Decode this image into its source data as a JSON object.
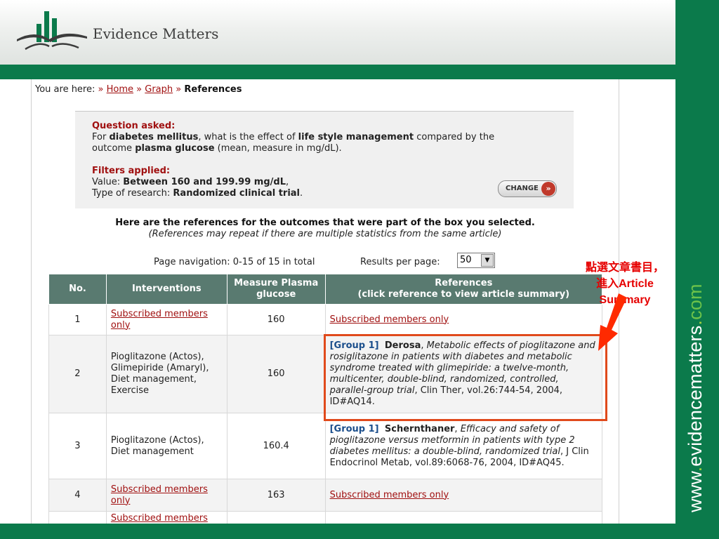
{
  "brand": {
    "name": "Evidence Matters",
    "url_prefix": "www",
    "url_dot": ".",
    "url_domain": "evidencematters",
    "url_dot2": ".",
    "url_tld": "com"
  },
  "breadcrumb": {
    "prefix": "You are here:",
    "sep": "»",
    "home": "Home",
    "graph": "Graph",
    "current": "References"
  },
  "question": {
    "title": "Question asked:",
    "line1_a": "For ",
    "line1_b": "diabetes mellitus",
    "line1_c": ", what is the effect of ",
    "line1_d": "life style management",
    "line1_e": " compared by the",
    "line2_a": "outcome ",
    "line2_b": "plasma glucose",
    "line2_c": " (mean, measure in mg/dL)."
  },
  "filters": {
    "title": "Filters applied:",
    "value_label": "Value: ",
    "value": "Between 160 and 199.99 mg/dL",
    "value_suffix": ",",
    "type_label": "Type of research: ",
    "type": "Randomized clinical trial",
    "type_suffix": ".",
    "change_label": "CHANGE",
    "change_arrow": "»"
  },
  "heading": "Here are the references for the outcomes that were part of the box you selected.",
  "subheading": "(References may repeat if there are multiple statistics from the same article)",
  "pagination": {
    "nav_text": "Page navigation: 0-15 of 15 in total",
    "per_page_label": "Results per page:",
    "per_page_value": "50",
    "dropdown_glyph": "▼"
  },
  "table": {
    "headers": {
      "no": "No.",
      "interventions": "Interventions",
      "measure_1": "Measure Plasma",
      "measure_2": "glucose",
      "references_1": "References",
      "references_2": "(click reference to view article summary)"
    },
    "rows": [
      {
        "no": "1",
        "interventions": "Subscribed members only",
        "measure": "160",
        "reference": "Subscribed members only"
      },
      {
        "no": "2",
        "interventions": "Pioglitazone (Actos), Glimepiride (Amaryl), Diet management, Exercise",
        "measure": "160",
        "group": "[Group 1]",
        "author": "Derosa",
        "author_sep": ", ",
        "title": "Metabolic effects of pioglitazone and rosiglitazone in patients with diabetes and metabolic syndrome treated with glimepiride: a twelve-month, multicenter, double-blind, randomized, controlled, parallel-group trial",
        "citation": ", Clin Ther, vol.26:744-54, 2004, ID#AQ14."
      },
      {
        "no": "3",
        "interventions": "Pioglitazone (Actos), Diet management",
        "measure": "160.4",
        "group": "[Group 1]",
        "author": "Schernthaner",
        "author_sep": ", ",
        "title": "Efficacy and safety of pioglitazone versus metformin in patients with type 2 diabetes mellitus: a double-blind, randomized trial",
        "citation": ", J Clin Endocrinol Metab, vol.89:6068-76, 2004, ID#AQ45."
      },
      {
        "no": "4",
        "interventions": "Subscribed members only",
        "measure": "163",
        "reference": "Subscribed members only"
      },
      {
        "no": "",
        "interventions": "Subscribed members",
        "measure": "",
        "reference": ""
      }
    ]
  },
  "annotation": {
    "line1": "點選文章書目，",
    "line2": "進入Article",
    "line3": "Summary"
  },
  "colors": {
    "brand_green": "#0b7a4b",
    "header_green": "#597a70",
    "link_red": "#a01010",
    "highlight_orange": "#e04a1c",
    "annotation_red": "#e60000",
    "group_blue": "#1c4f8c"
  }
}
